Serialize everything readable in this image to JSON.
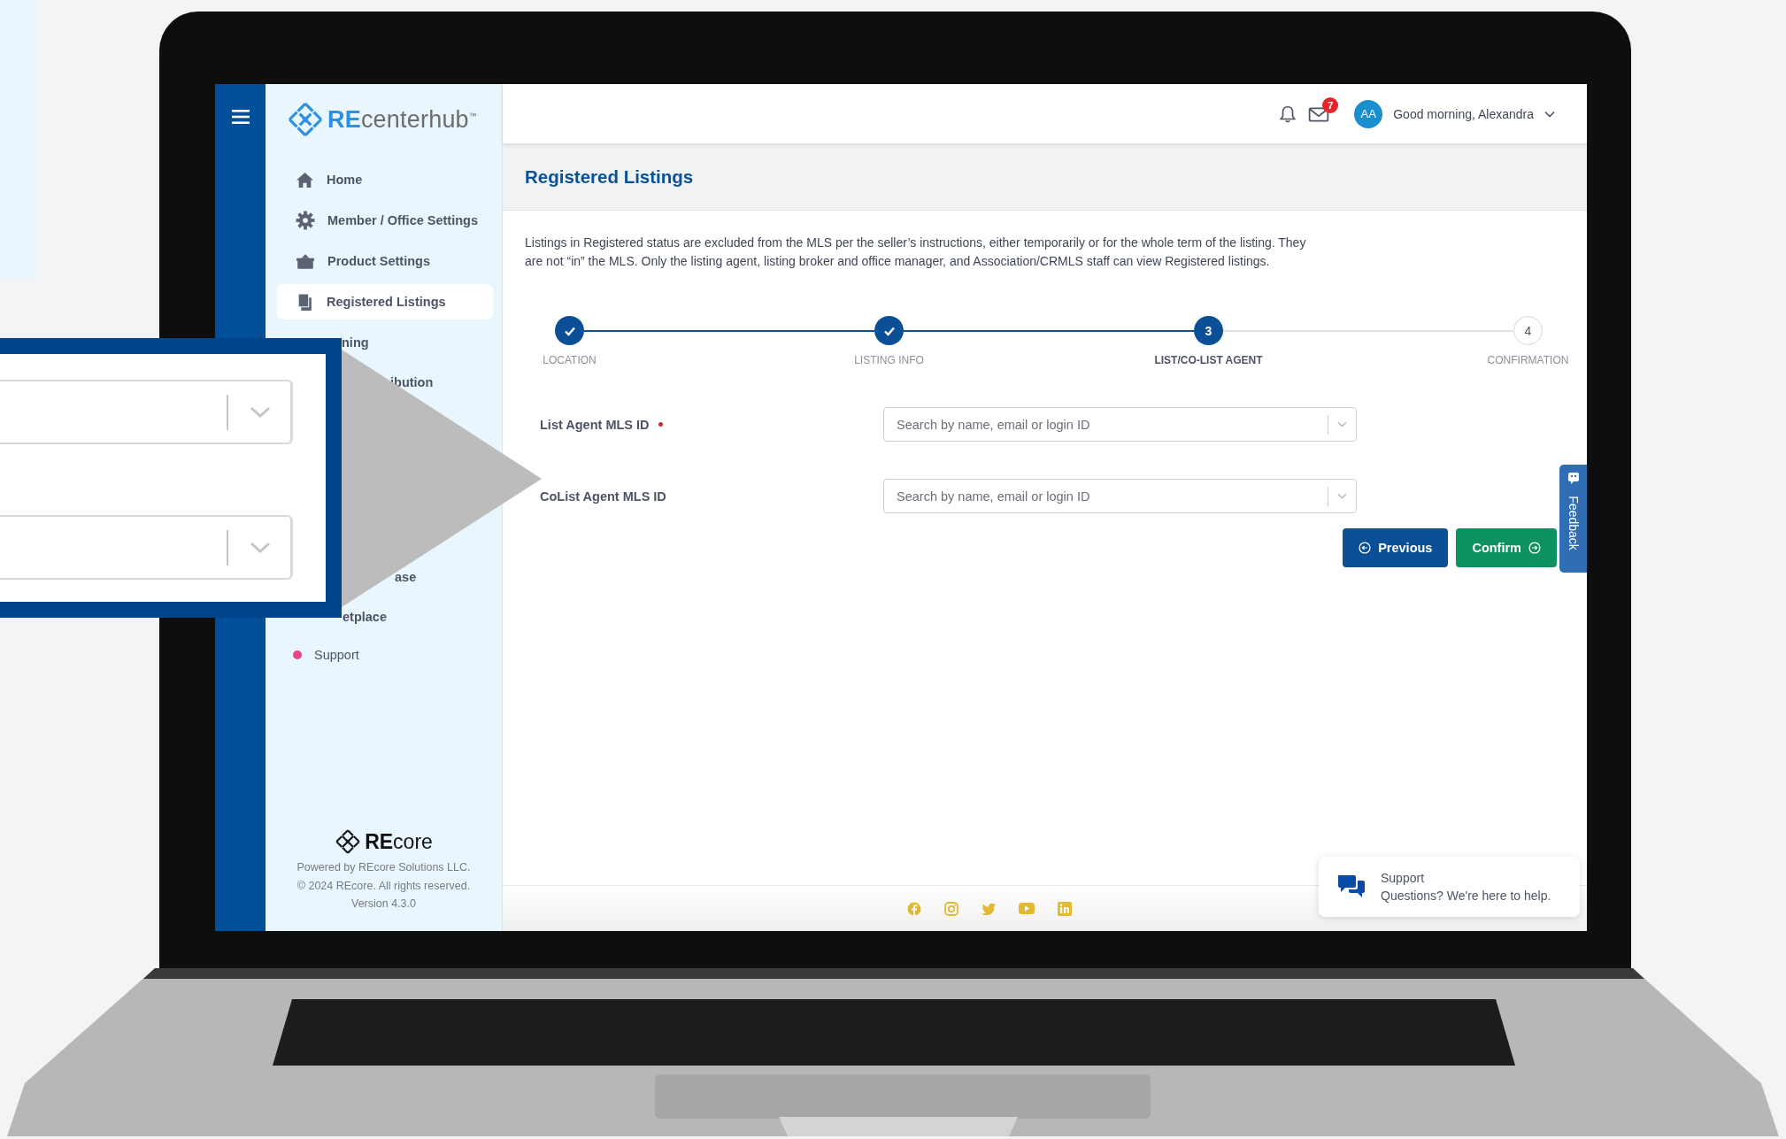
{
  "topbar": {
    "badge": "7",
    "avatar_initials": "AA",
    "greeting": "Good morning, Alexandra"
  },
  "brand": {
    "logo": "**RE**centerhub$^{™}$"
  },
  "sidebar": {
    "items": [
      {
        "label": "Home",
        "kind": "home",
        "selected": false
      },
      {
        "label": "Member / Office Settings",
        "kind": "gear",
        "selected": false
      },
      {
        "label": "Product Settings",
        "kind": "product",
        "selected": false
      },
      {
        "label": "Registered Listings",
        "kind": "listings",
        "selected": true
      },
      {
        "label": "ning",
        "kind": "partial",
        "selected": false
      },
      {
        "label": "ibution",
        "kind": "partial",
        "selected": false
      },
      {
        "label": "ase",
        "kind": "partial",
        "selected": false
      },
      {
        "label": "etplace",
        "kind": "partial",
        "selected": false
      },
      {
        "label": "Support",
        "kind": "dot",
        "selected": false,
        "color": "#e8458b"
      }
    ],
    "footer": {
      "brand": "**RE**core",
      "lines": [
        "Powered by REcore Solutions LLC.",
        "© 2024 REcore. All rights reserved.",
        "Version 4.3.0"
      ]
    }
  },
  "page": {
    "title": "Registered Listings",
    "description": "Listings in Registered status are excluded from the MLS per the seller’s instructions, either temporarily or for the whole term of the listing. They are not “in” the MLS. Only the listing agent, listing broker and office manager, and Association/CRMLS staff can view Registered listings.",
    "steps": [
      {
        "label": "LOCATION",
        "done": true,
        "selected": false
      },
      {
        "label": "LISTING INFO",
        "done": true,
        "selected": false
      },
      {
        "label": "LIST/CO-LIST AGENT",
        "done": false,
        "selected": true,
        "number": "3"
      },
      {
        "label": "CONFIRMATION",
        "done": false,
        "selected": false,
        "number": "4"
      }
    ],
    "fields": [
      {
        "label": "List Agent MLS ID",
        "required": true,
        "placeholder": "Search by name, email or login ID"
      },
      {
        "label": "CoList Agent MLS ID",
        "required": false,
        "placeholder": "Search by name, email or login ID"
      }
    ],
    "buttons": [
      {
        "label": "Previous",
        "kind": "previous"
      },
      {
        "label": "Confirm",
        "kind": "confirm"
      }
    ]
  },
  "feedback_tab": {
    "label": "Feedback"
  },
  "support_card": {
    "title": "Support",
    "subtitle": "Questions? We're here to help."
  }
}
